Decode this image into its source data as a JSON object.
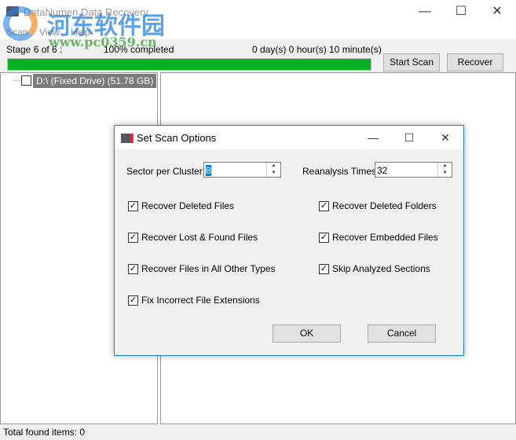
{
  "window": {
    "title": "DataNumen Data Recovery",
    "minimize": "—",
    "maximize": "☐",
    "close": "✕"
  },
  "menu": [
    "Scan",
    "View",
    "Help"
  ],
  "progress": {
    "stage": "Stage 6 of 6 :",
    "percent_text": "100% completed",
    "percent": 100,
    "elapsed": "0 day(s) 0 hour(s) 10 minute(s)",
    "color": "#06b025"
  },
  "toolbar": {
    "start_scan": "Start Scan",
    "recover": "Recover"
  },
  "tree": {
    "drive": "D:\\  (Fixed Drive)  (51.78 GB)"
  },
  "status": "Total found items: 0",
  "watermark": {
    "cn": "河东软件园",
    "url": "www.pc0359.cn"
  },
  "dialog": {
    "title": "Set Scan Options",
    "minimize": "—",
    "maximize": "☐",
    "close": "✕",
    "sector_label": "Sector per Cluster:",
    "sector_value": "8",
    "reanalysis_label": "Reanalysis Times:",
    "reanalysis_value": "32",
    "options": [
      {
        "label": "Recover Deleted Files",
        "checked": true
      },
      {
        "label": "Recover Deleted Folders",
        "checked": true
      },
      {
        "label": "Recover Lost & Found Files",
        "checked": true
      },
      {
        "label": "Recover Embedded Files",
        "checked": true
      },
      {
        "label": "Recover Files in All Other Types",
        "checked": true
      },
      {
        "label": "Skip Analyzed Sections",
        "checked": true
      },
      {
        "label": "Fix Incorrect File Extensions",
        "checked": true
      }
    ],
    "ok": "OK",
    "cancel": "Cancel"
  }
}
